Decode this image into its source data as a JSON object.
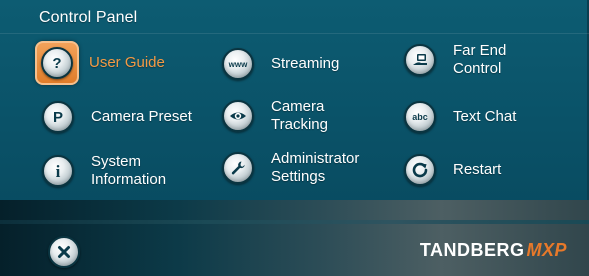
{
  "panel": {
    "title": "Control Panel"
  },
  "items": {
    "user_guide": {
      "label": "User Guide",
      "icon": "question-icon",
      "selected": true
    },
    "camera_preset": {
      "label": "Camera Preset",
      "icon": "camera-preset-p-icon"
    },
    "system_information": {
      "label_line1": "System",
      "label_line2": "Information",
      "icon": "info-icon"
    },
    "streaming": {
      "label": "Streaming",
      "icon": "www-icon"
    },
    "camera_tracking": {
      "label_line1": "Camera",
      "label_line2": "Tracking",
      "icon": "eye-icon"
    },
    "administrator_settings": {
      "label_line1": "Administrator",
      "label_line2": "Settings",
      "icon": "wrench-icon"
    },
    "far_end_control": {
      "label_line1": "Far End",
      "label_line2": "Control",
      "icon": "far-end-control-icon"
    },
    "text_chat": {
      "label": "Text Chat",
      "icon": "abc-icon"
    },
    "restart": {
      "label": "Restart",
      "icon": "restart-icon"
    }
  },
  "footer": {
    "brand_main": "TANDBERG",
    "brand_sub": "MXP",
    "close_icon": "close-icon"
  },
  "colors": {
    "accent": "#e8792a",
    "panel_bg": "#0a5268",
    "selected_text": "#f39a45"
  }
}
